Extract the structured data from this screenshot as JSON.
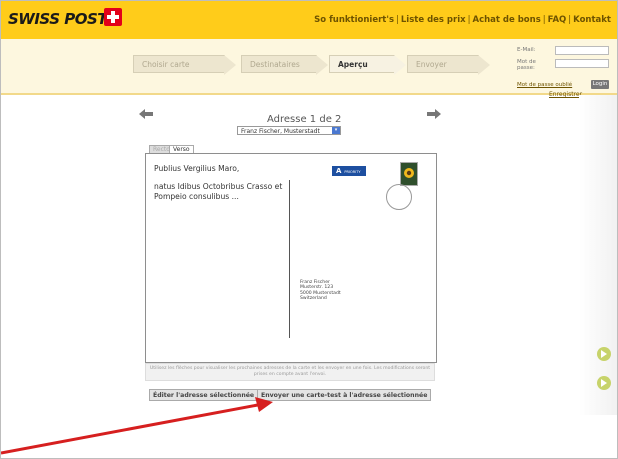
{
  "header": {
    "logo": "SWISS POST",
    "nav": [
      "So funktioniert's",
      "Liste des prix",
      "Achat de bons",
      "FAQ",
      "Kontakt"
    ]
  },
  "steps": [
    "Choisir carte",
    "Destinataires",
    "Aperçu",
    "Envoyer"
  ],
  "login": {
    "email_label": "E-Mail:",
    "password_label": "Mot de passe:",
    "forgot": "Mot de passe oublié",
    "login_button": "Login",
    "register": "Enregistrer"
  },
  "address": {
    "label": "Adresse 1 de 2",
    "selected": "Franz Fischer, Musterstadt"
  },
  "tabs": [
    "Recto",
    "Verso"
  ],
  "card": {
    "message_line1": "Publius Vergilius Maro,",
    "message_line2": "natus Idibus Octobribus Crasso et Pompeio consulibus ...",
    "apost": "A",
    "apost_small": "PRIORITY",
    "recipient": [
      "Franz Fischer",
      "Musterstr. 123",
      "5000  Musterstadt",
      "Switzerland"
    ]
  },
  "info_text": "Utilisez les flèches pour visualiser les prochaines adresses de la carte et les envoyer en une fois. Les modifications seront prises en compte avant l'envoi.",
  "buttons": {
    "edit": "Éditer l'adresse sélectionnée",
    "send": "Envoyer une carte-test à l'adresse sélectionnée"
  },
  "colors": {
    "brand": "#ffcc1a",
    "apost_blue": "#1d4fa0",
    "annotation_red": "#d61f1f"
  }
}
